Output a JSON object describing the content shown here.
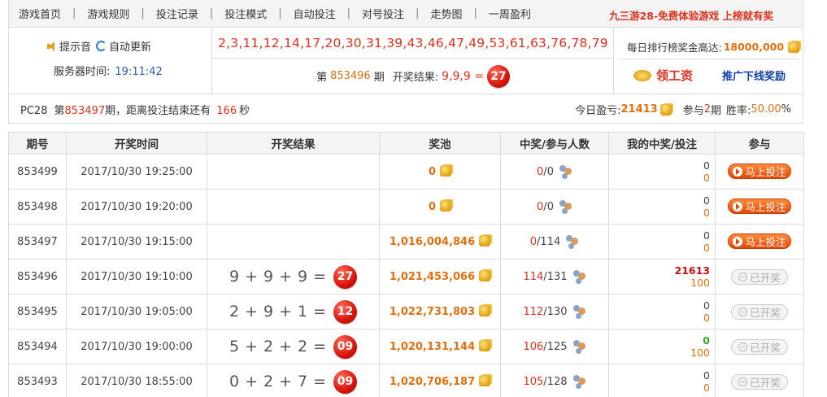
{
  "nav": {
    "items": [
      "游戏首页",
      "游戏规则",
      "投注记录",
      "投注模式",
      "自动投注",
      "对号投注",
      "走势图",
      "一周盈利"
    ],
    "separator": "|",
    "promo": "九三游28-免费体验游戏 上榜就有奖"
  },
  "options": {
    "sound": "提示音",
    "auto_refresh": "自动更新",
    "server_time_label": "服务器时间:",
    "server_time": "19:11:42"
  },
  "draw_numbers": "2,3,11,12,14,17,20,30,31,39,43,46,47,49,53,61,63,76,78,79",
  "last_result": {
    "prefix": "第",
    "period": "853496",
    "suffix": "期",
    "label": "开奖结果:",
    "expr": "9,9,9 =",
    "sum": "27"
  },
  "daily": {
    "label": "每日排行榜奖金高达:",
    "amount": "18000,000"
  },
  "salary_label": "领工资",
  "promo_link": "推广下线奖励",
  "status": {
    "game": "PC28",
    "prefix": "第",
    "period": "853497",
    "mid": "期，距离投注结束还有",
    "seconds": "166",
    "unit": "秒",
    "profit_label": "今日盈亏:",
    "profit": "21413",
    "join_label": "参与",
    "join_count": "2",
    "join_unit": "期",
    "rate_label": "胜率:",
    "rate": "50.00",
    "rate_unit": "%"
  },
  "table": {
    "headers": [
      "期号",
      "开奖时间",
      "开奖结果",
      "奖池",
      "中奖/参与人数",
      "我的中奖/投注",
      "参与"
    ],
    "rows": [
      {
        "period": "853499",
        "time": "2017/10/30 19:25:00",
        "nums": [],
        "sum": "",
        "pool": "0",
        "win": "0",
        "total": "0",
        "my_win": "0",
        "my_bet": "0",
        "action": "马上投注",
        "open": true
      },
      {
        "period": "853498",
        "time": "2017/10/30 19:20:00",
        "nums": [],
        "sum": "",
        "pool": "0",
        "win": "0",
        "total": "0",
        "my_win": "0",
        "my_bet": "0",
        "action": "马上投注",
        "open": true
      },
      {
        "period": "853497",
        "time": "2017/10/30 19:15:00",
        "nums": [],
        "sum": "",
        "pool": "1,016,004,846",
        "win": "0",
        "total": "114",
        "my_win": "0",
        "my_bet": "0",
        "action": "马上投注",
        "open": true
      },
      {
        "period": "853496",
        "time": "2017/10/30 19:10:00",
        "nums": [
          "9",
          "9",
          "9"
        ],
        "sum": "27",
        "pool": "1,021,453,066",
        "win": "114",
        "total": "131",
        "my_win": "21613",
        "my_bet": "100",
        "action": "已开奖",
        "open": false,
        "win_style": "big"
      },
      {
        "period": "853495",
        "time": "2017/10/30 19:05:00",
        "nums": [
          "2",
          "9",
          "1"
        ],
        "sum": "12",
        "pool": "1,022,731,803",
        "win": "112",
        "total": "130",
        "my_win": "0",
        "my_bet": "0",
        "action": "已开奖",
        "open": false
      },
      {
        "period": "853494",
        "time": "2017/10/30 19:00:00",
        "nums": [
          "5",
          "2",
          "2"
        ],
        "sum": "09",
        "pool": "1,020,131,144",
        "win": "106",
        "total": "125",
        "my_win": "0",
        "my_bet": "100",
        "action": "已开奖",
        "open": false,
        "win_style": "green"
      },
      {
        "period": "853493",
        "time": "2017/10/30 18:55:00",
        "nums": [
          "0",
          "2",
          "7"
        ],
        "sum": "09",
        "pool": "1,020,706,187",
        "win": "105",
        "total": "128",
        "my_win": "0",
        "my_bet": "0",
        "action": "已开奖",
        "open": false
      }
    ]
  },
  "colors": {
    "accent_red": "#e0301e",
    "accent_orange": "#e07010",
    "link_blue": "#1440a8",
    "win_green": "#2ea82e"
  }
}
